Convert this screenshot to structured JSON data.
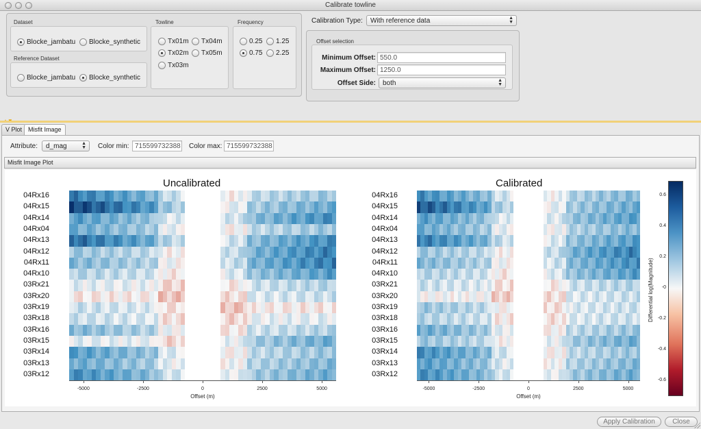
{
  "window": {
    "title": "Calibrate towline"
  },
  "dataset": {
    "title": "Dataset",
    "options": [
      "Blocke_jambatu",
      "Blocke_synthetic"
    ],
    "selected": 0
  },
  "reference_dataset": {
    "title": "Reference Dataset",
    "options": [
      "Blocke_jambatu",
      "Blocke_synthetic"
    ],
    "selected": 1
  },
  "towline": {
    "title": "Towline",
    "options": [
      "Tx01m",
      "Tx04m",
      "Tx02m",
      "Tx05m",
      "Tx03m"
    ],
    "selected": 2
  },
  "frequency": {
    "title": "Frequency",
    "options": [
      "0.25",
      "1.25",
      "0.75",
      "2.25"
    ],
    "selected": 2
  },
  "calibration": {
    "label": "Calibration Type:",
    "value": "With reference data"
  },
  "offset_selection": {
    "title": "Offset selection",
    "min_label": "Minimum Offset:",
    "min_value": "550.0",
    "max_label": "Maximum Offset:",
    "max_value": "1250.0",
    "side_label": "Offset Side:",
    "side_value": "both"
  },
  "tabs": [
    "V Plot",
    "Misfit Image"
  ],
  "active_tab": 1,
  "controls": {
    "attribute_label": "Attribute:",
    "attribute_value": "d_mag",
    "color_min_label": "Color min:",
    "color_min_value": "715599732388",
    "color_max_label": "Color max:",
    "color_max_value": "715599732388"
  },
  "section_title": "Misfit Image Plot",
  "chart_data": {
    "type": "heatmap",
    "row_labels": [
      "04Rx16",
      "04Rx15",
      "04Rx14",
      "04Rx04",
      "04Rx13",
      "04Rx12",
      "04Rx11",
      "04Rx10",
      "03Rx21",
      "03Rx20",
      "03Rx19",
      "03Rx18",
      "03Rx16",
      "03Rx15",
      "03Rx14",
      "03Rx13",
      "03Rx12"
    ],
    "x_ticks": [
      "-5000",
      "-2500",
      "0",
      "2500",
      "5000"
    ],
    "x_tick_values": [
      -5000,
      -2500,
      0,
      2500,
      5000
    ],
    "xlim": [
      -5600,
      5600
    ],
    "gap_range": [
      -700,
      700
    ],
    "xlabel": "Offset (m)",
    "panels": [
      {
        "title": "Uncalibrated",
        "rows": [
          [
            0.45,
            0.2
          ],
          [
            0.6,
            0.3
          ],
          [
            0.35,
            0.4
          ],
          [
            0.3,
            0.2
          ],
          [
            0.5,
            0.4
          ],
          [
            0.2,
            0.45
          ],
          [
            0.25,
            0.45
          ],
          [
            0.15,
            0.35
          ],
          [
            0.05,
            0.15
          ],
          [
            -0.05,
            0.1
          ],
          [
            0.1,
            -0.05
          ],
          [
            0.1,
            0.05
          ],
          [
            0.25,
            0.15
          ],
          [
            0.05,
            0.3
          ],
          [
            0.35,
            0.2
          ],
          [
            0.3,
            0.25
          ],
          [
            0.4,
            0.3
          ]
        ]
      },
      {
        "title": "Calibrated",
        "rows": [
          [
            0.4,
            0.25
          ],
          [
            0.55,
            0.3
          ],
          [
            0.35,
            0.35
          ],
          [
            0.3,
            0.25
          ],
          [
            0.45,
            0.35
          ],
          [
            0.2,
            0.45
          ],
          [
            0.25,
            0.4
          ],
          [
            0.15,
            0.35
          ],
          [
            0.1,
            0.15
          ],
          [
            0.0,
            0.1
          ],
          [
            0.2,
            0.1
          ],
          [
            0.15,
            0.1
          ],
          [
            0.3,
            0.2
          ],
          [
            0.2,
            0.3
          ],
          [
            0.4,
            0.2
          ],
          [
            0.35,
            0.25
          ],
          [
            0.4,
            0.3
          ]
        ]
      }
    ],
    "colorbar": {
      "title": "Differential log(Magnitude)",
      "ticks": [
        "0.6",
        "0.4",
        "0.2",
        "-0",
        "-0.2",
        "-0.4",
        "-0.6"
      ],
      "range": [
        -0.7,
        0.7
      ]
    }
  },
  "buttons": {
    "apply": "Apply Calibration",
    "close": "Close"
  }
}
